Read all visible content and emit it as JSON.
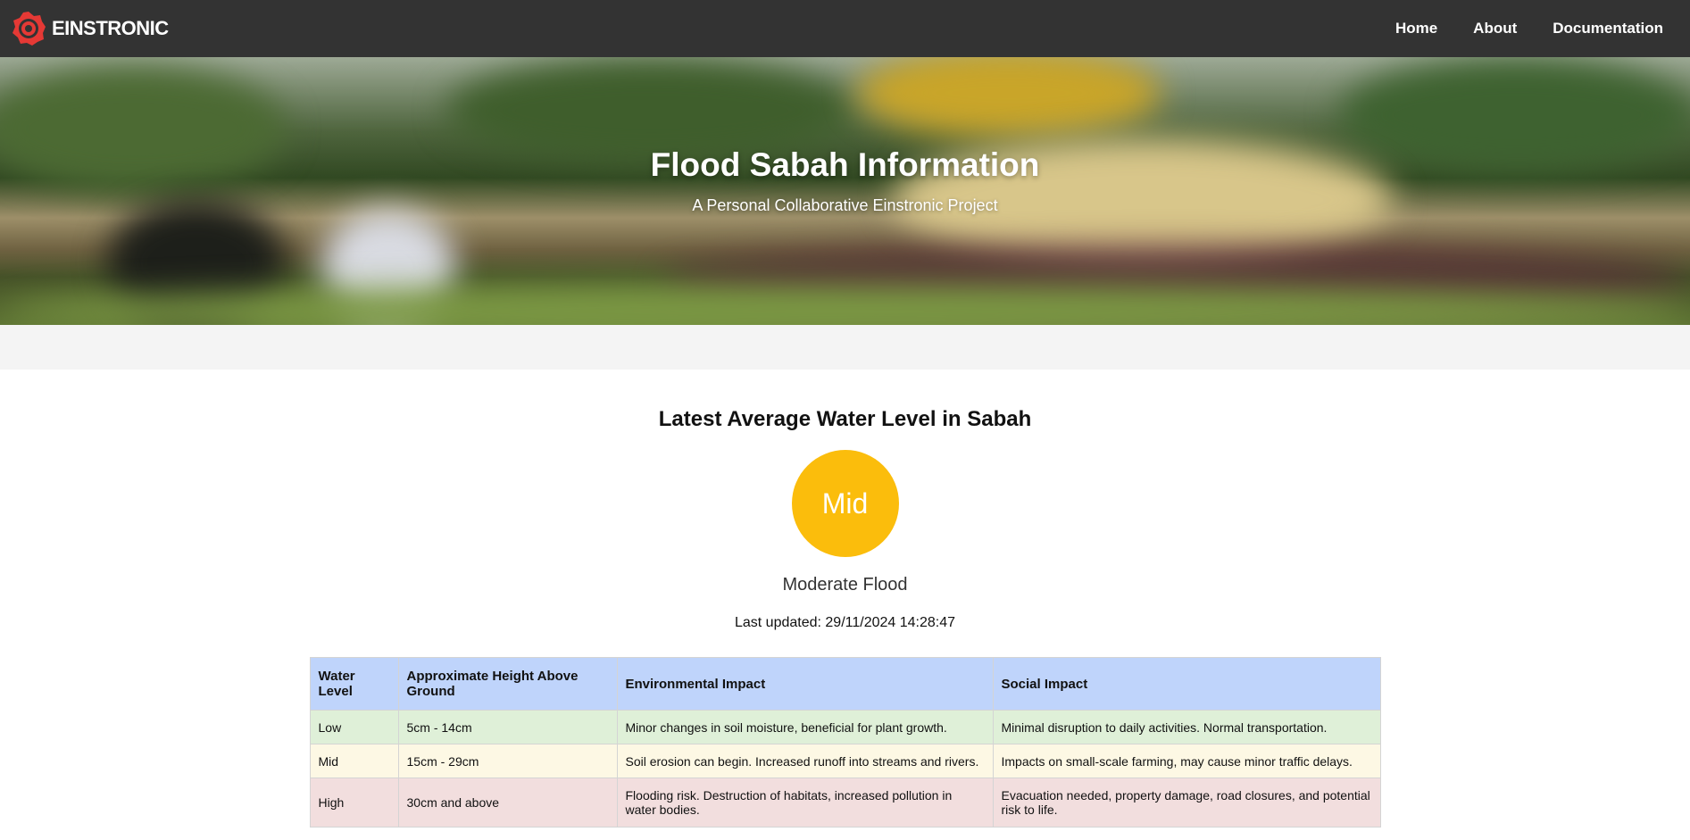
{
  "nav": {
    "brand": "EINSTRONIC",
    "links": [
      "Home",
      "About",
      "Documentation"
    ]
  },
  "hero": {
    "title": "Flood Sabah Information",
    "subtitle": "A Personal Collaborative Einstronic Project"
  },
  "status": {
    "heading": "Latest Average Water Level in Sabah",
    "level": "Mid",
    "description": "Moderate Flood",
    "last_updated": "Last updated: 29/11/2024 14:28:47",
    "level_color": "#fbbd0c"
  },
  "table": {
    "headers": [
      "Water Level",
      "Approximate Height Above Ground",
      "Environmental Impact",
      "Social Impact"
    ],
    "rows": [
      [
        "Low",
        "5cm - 14cm",
        "Minor changes in soil moisture, beneficial for plant growth.",
        "Minimal disruption to daily activities. Normal transportation."
      ],
      [
        "Mid",
        "15cm - 29cm",
        "Soil erosion can begin. Increased runoff into streams and rivers.",
        "Impacts on small-scale farming, may cause minor traffic delays."
      ],
      [
        "High",
        "30cm and above",
        "Flooding risk. Destruction of habitats, increased pollution in water bodies.",
        "Evacuation needed, property damage, road closures, and potential risk to life."
      ]
    ]
  },
  "colors": {
    "navbar": "#333333",
    "header_row": "#bfd4fb",
    "low_row": "#dff0d8",
    "mid_row": "#fdf8e4",
    "high_row": "#f2dede",
    "brand_red": "#e53935"
  }
}
